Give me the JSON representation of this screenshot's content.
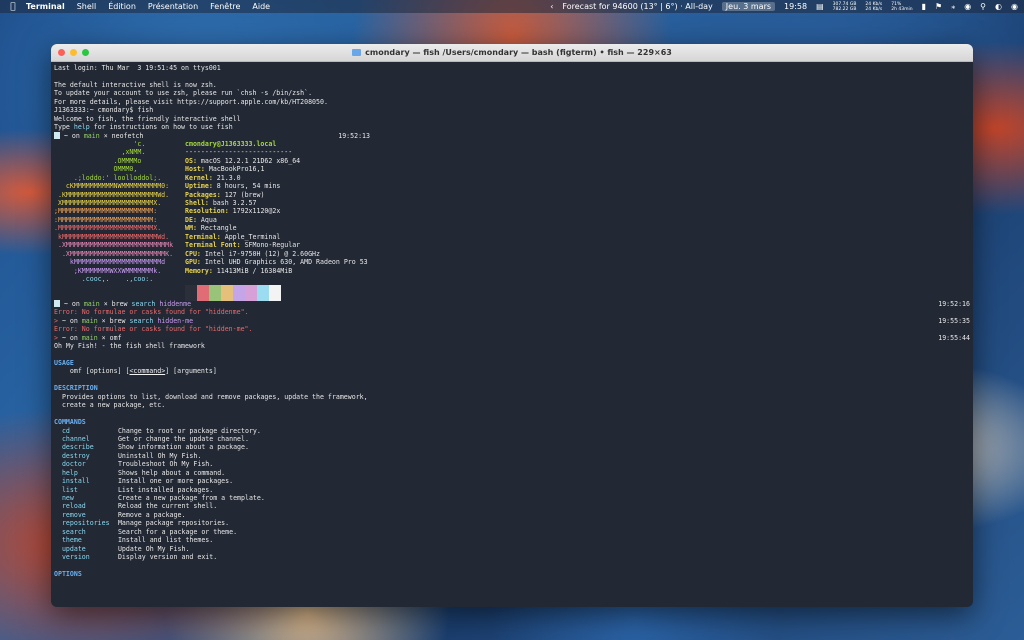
{
  "menubar": {
    "app_name": "Terminal",
    "menus": [
      "Shell",
      "Édition",
      "Présentation",
      "Fenêtre",
      "Aide"
    ],
    "forecast": "Forecast for 94600 (13° | 6°) · All-day",
    "date": "Jeu. 3 mars",
    "time": "19:58",
    "disk_a": "307.74 GB",
    "disk_b": "782.22 GB",
    "net_up": "24 Kb/s",
    "net_down": "24 Kb/s",
    "battery_pct": "71%",
    "battery_time": "2h 43min"
  },
  "window": {
    "title": "cmondary — fish /Users/cmondary — bash (figterm) • fish — 229×63"
  },
  "terminal": {
    "pre_lines": [
      "Last login: Thu Mar  3 19:51:45 on ttys001",
      "",
      "The default interactive shell is now zsh.",
      "To update your account to use zsh, please run `chsh -s /bin/zsh`.",
      "For more details, please visit https://support.apple.com/kb/HT208050.",
      "J1363333:~ cmondary$ fish",
      "Welcome to fish, the friendly interactive shell"
    ],
    "help_prefix": "Type ",
    "help_word": "help",
    "help_suffix": " for instructions on how to use fish",
    "prompt1": " ~ on ",
    "branch": "main",
    "x": " × ",
    "cmd1": "neofetch",
    "ts1": "19:52:13",
    "art_lines": [
      "                    'c.",
      "                 ,xNMM.",
      "               .OMMMMo",
      "               OMMM0,",
      "     .;loddo:' loolloddol;.",
      "   cKMMMMMMMMMMNWMMMMMMMMMM0:",
      " .KMMMMMMMMMMMMMMMMMMMMMMMWd.",
      " XMMMMMMMMMMMMMMMMMMMMMMMX.",
      ";MMMMMMMMMMMMMMMMMMMMMMMM:",
      ":MMMMMMMMMMMMMMMMMMMMMMMM:",
      ".MMMMMMMMMMMMMMMMMMMMMMMMX.",
      " kMMMMMMMMMMMMMMMMMMMMMMMMWd.",
      " .XMMMMMMMMMMMMMMMMMMMMMMMMMMk",
      "  .XMMMMMMMMMMMMMMMMMMMMMMMMK.",
      "    kMMMMMMMMMMMMMMMMMMMMMMd",
      "     ;KMMMMMMMWXXWMMMMMMMk.",
      "       .cooc,.    .,coo:."
    ],
    "host": "cmondary@J1363333.local",
    "sep": "---------------------------",
    "info": [
      {
        "k": "OS",
        "v": "macOS 12.2.1 21D62 x86_64"
      },
      {
        "k": "Host",
        "v": "MacBookPro16,1"
      },
      {
        "k": "Kernel",
        "v": "21.3.0"
      },
      {
        "k": "Uptime",
        "v": "8 hours, 54 mins"
      },
      {
        "k": "Packages",
        "v": "127 (brew)"
      },
      {
        "k": "Shell",
        "v": "bash 3.2.57"
      },
      {
        "k": "Resolution",
        "v": "1792x1120@2x"
      },
      {
        "k": "DE",
        "v": "Aqua"
      },
      {
        "k": "WM",
        "v": "Rectangle"
      },
      {
        "k": "Terminal",
        "v": "Apple_Terminal"
      },
      {
        "k": "Terminal Font",
        "v": "SFMono-Regular"
      },
      {
        "k": "CPU",
        "v": "Intel i7-9750H (12) @ 2.60GHz"
      },
      {
        "k": "GPU",
        "v": "Intel UHD Graphics 630, AMD Radeon Pro 53"
      },
      {
        "k": "Memory",
        "v": "11413MiB / 16384MiB"
      }
    ],
    "swatch_colors": [
      "#2a2f3a",
      "#e06c75",
      "#98c379",
      "#e5c07b",
      "#c4a6e8",
      "#d7a0d7",
      "#9bdcf0",
      "#f3f3f3"
    ],
    "brew_word": "brew",
    "search_word": "search",
    "cmd2_arg": "hiddenme",
    "ts2": "19:52:16",
    "err1": "Error: No formulae or casks found for \"hiddenme\".",
    "cmd3_arg": "hidden-me",
    "ts3": "19:55:35",
    "err2": "Error: No formulae or casks found for \"hidden-me\".",
    "cmd4": "omf",
    "ts4": "19:55:44",
    "omf_title": "Oh My Fish! - the fish shell framework",
    "usage_h": "USAGE",
    "usage_omf": "omf",
    "usage_opts": " [options] [",
    "usage_cmd": "<command>",
    "usage_args": "] [arguments]",
    "desc_h": "DESCRIPTION",
    "desc_1": "Provides options to list, download and remove packages, update the framework,",
    "desc_2": "create a new package, etc.",
    "commands_h": "COMMANDS",
    "commands": [
      {
        "n": "cd",
        "d": "Change to root or package directory."
      },
      {
        "n": "channel",
        "d": "Get or change the update channel."
      },
      {
        "n": "describe",
        "d": "Show information about a package."
      },
      {
        "n": "destroy",
        "d": "Uninstall Oh My Fish."
      },
      {
        "n": "doctor",
        "d": "Troubleshoot Oh My Fish."
      },
      {
        "n": "help",
        "d": "Shows help about a command."
      },
      {
        "n": "install",
        "d": "Install one or more packages."
      },
      {
        "n": "list",
        "d": "List installed packages."
      },
      {
        "n": "new",
        "d": "Create a new package from a template."
      },
      {
        "n": "reload",
        "d": "Reload the current shell."
      },
      {
        "n": "remove",
        "d": "Remove a package."
      },
      {
        "n": "repositories",
        "d": "Manage package repositories."
      },
      {
        "n": "search",
        "d": "Search for a package or theme."
      },
      {
        "n": "theme",
        "d": "Install and list themes."
      },
      {
        "n": "update",
        "d": "Update Oh My Fish."
      },
      {
        "n": "version",
        "d": "Display version and exit."
      }
    ],
    "options_h": "OPTIONS"
  }
}
